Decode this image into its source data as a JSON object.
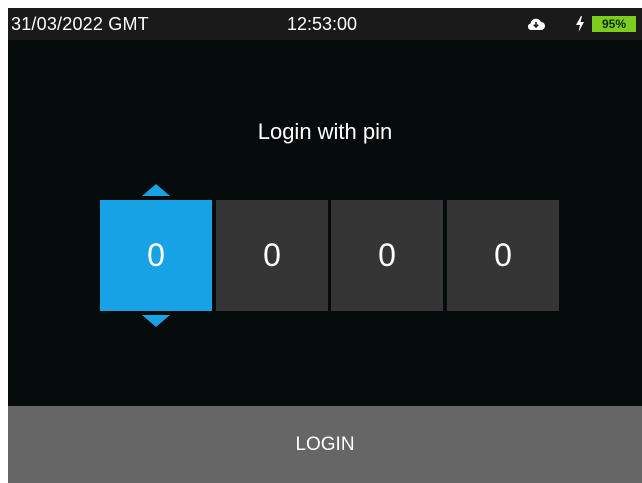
{
  "status_bar": {
    "date": "31/03/2022 GMT",
    "time": "12:53:00",
    "battery_percent": "95%",
    "cloud_icon": "cloud-icon",
    "charging_icon": "bolt-icon"
  },
  "login": {
    "title": "Login with pin",
    "pin_digits": [
      "0",
      "0",
      "0",
      "0"
    ],
    "active_digit_index": 0,
    "button_label": "LOGIN"
  },
  "colors": {
    "background": "#050a0a",
    "status_bar": "#1a1a1a",
    "active_digit": "#16a2e4",
    "inactive_digit": "#353535",
    "button": "#666666",
    "battery": "#7dcc1e"
  }
}
